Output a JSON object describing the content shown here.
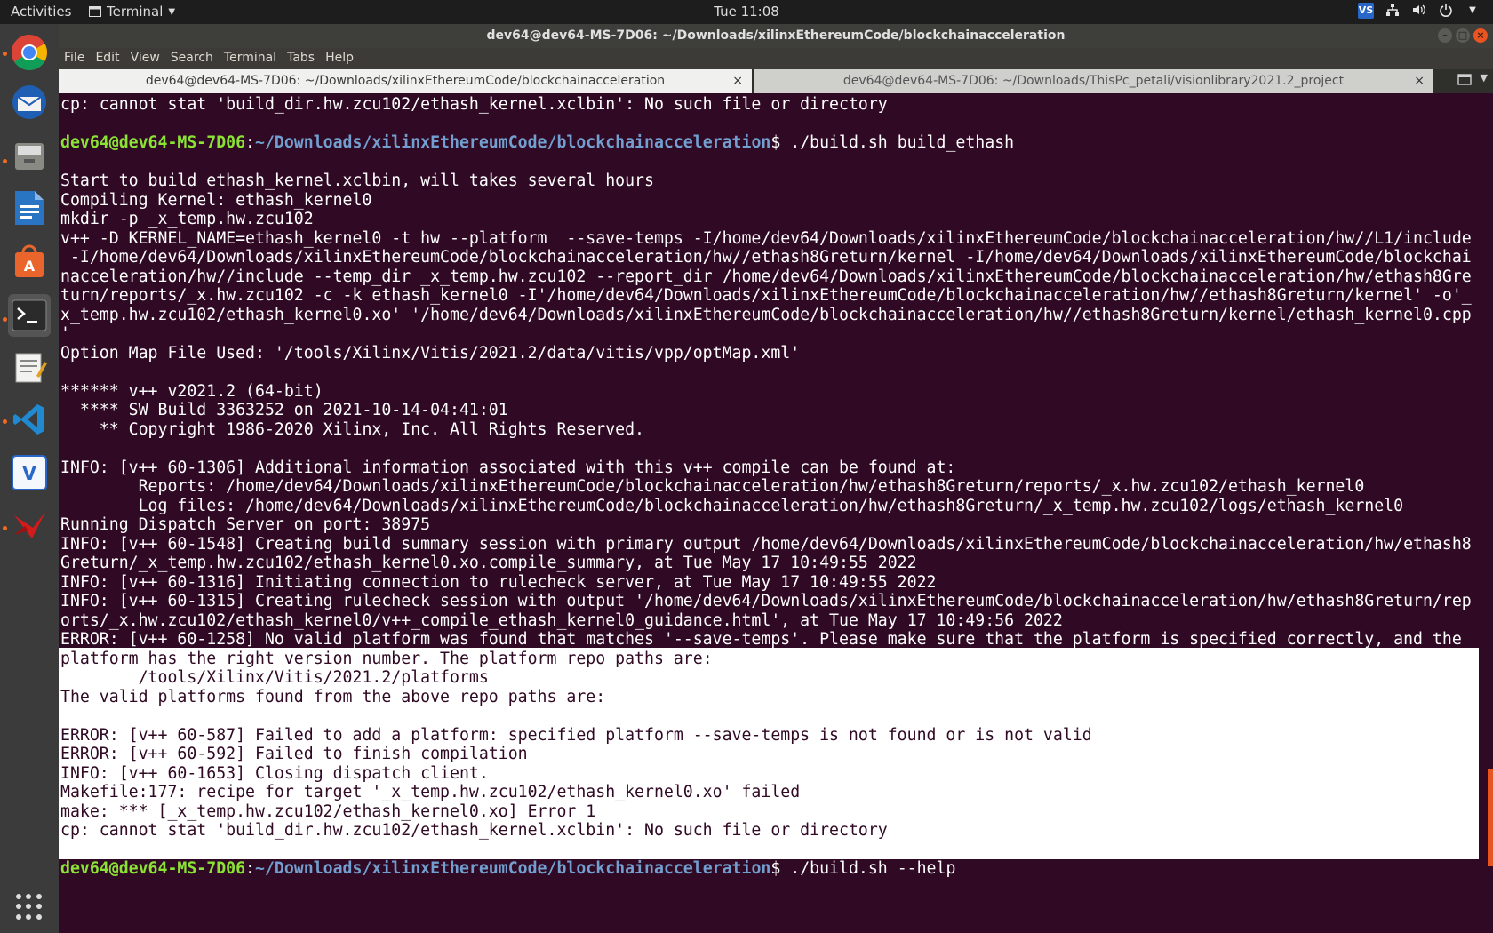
{
  "topbar": {
    "activities": "Activities",
    "app_name": "Terminal",
    "clock": "Tue 11:08",
    "tray_badge": "VS"
  },
  "dock": {
    "items": [
      "chrome",
      "thunderbird",
      "files",
      "writer",
      "software",
      "terminal",
      "text-editor",
      "vscode",
      "vitis",
      "xilinx"
    ]
  },
  "window": {
    "title": "dev64@dev64-MS-7D06: ~/Downloads/xilinxEthereumCode/blockchainacceleration",
    "menu": [
      "File",
      "Edit",
      "View",
      "Search",
      "Terminal",
      "Tabs",
      "Help"
    ],
    "tabs": [
      {
        "label": "dev64@dev64-MS-7D06: ~/Downloads/xilinxEthereumCode/blockchainacceleration",
        "active": true
      },
      {
        "label": "dev64@dev64-MS-7D06: ~/Downloads/ThisPc_petali/visionlibrary2021.2_project",
        "active": false
      }
    ],
    "tab_close": "×"
  },
  "terminal": {
    "prompt_user": "dev64@dev64-MS-7D06",
    "prompt_path": "~/Downloads/xilinxEthereumCode/blockchainacceleration",
    "lines": [
      "cp: cannot stat 'build_dir.hw.zcu102/ethash_kernel.xclbin': No such file or directory",
      "",
      "$ ./build.sh build_ethash",
      "",
      "Start to build ethash_kernel.xclbin, will takes several hours",
      "Compiling Kernel: ethash_kernel0",
      "mkdir -p _x_temp.hw.zcu102",
      "v++ -D KERNEL_NAME=ethash_kernel0 -t hw --platform  --save-temps -I/home/dev64/Downloads/xilinxEthereumCode/blockchainacceleration/hw//L1/include",
      " -I/home/dev64/Downloads/xilinxEthereumCode/blockchainacceleration/hw//ethash8Greturn/kernel -I/home/dev64/Downloads/xilinxEthereumCode/blockchai",
      "nacceleration/hw//include --temp_dir _x_temp.hw.zcu102 --report_dir /home/dev64/Downloads/xilinxEthereumCode/blockchainacceleration/hw/ethash8Gre",
      "turn/reports/_x.hw.zcu102 -c -k ethash_kernel0 -I'/home/dev64/Downloads/xilinxEthereumCode/blockchainacceleration/hw//ethash8Greturn/kernel' -o'_",
      "x_temp.hw.zcu102/ethash_kernel0.xo' '/home/dev64/Downloads/xilinxEthereumCode/blockchainacceleration/hw//ethash8Greturn/kernel/ethash_kernel0.cpp",
      "'",
      "Option Map File Used: '/tools/Xilinx/Vitis/2021.2/data/vitis/vpp/optMap.xml'",
      "",
      "****** v++ v2021.2 (64-bit)",
      "  **** SW Build 3363252 on 2021-10-14-04:41:01",
      "    ** Copyright 1986-2020 Xilinx, Inc. All Rights Reserved.",
      "",
      "INFO: [v++ 60-1306] Additional information associated with this v++ compile can be found at:",
      "        Reports: /home/dev64/Downloads/xilinxEthereumCode/blockchainacceleration/hw/ethash8Greturn/reports/_x.hw.zcu102/ethash_kernel0",
      "        Log files: /home/dev64/Downloads/xilinxEthereumCode/blockchainacceleration/hw/ethash8Greturn/_x_temp.hw.zcu102/logs/ethash_kernel0",
      "Running Dispatch Server on port: 38975",
      "INFO: [v++ 60-1548] Creating build summary session with primary output /home/dev64/Downloads/xilinxEthereumCode/blockchainacceleration/hw/ethash8",
      "Greturn/_x_temp.hw.zcu102/ethash_kernel0.xo.compile_summary, at Tue May 17 10:49:55 2022",
      "INFO: [v++ 60-1316] Initiating connection to rulecheck server, at Tue May 17 10:49:55 2022",
      "INFO: [v++ 60-1315] Creating rulecheck session with output '/home/dev64/Downloads/xilinxEthereumCode/blockchainacceleration/hw/ethash8Greturn/rep",
      "orts/_x.hw.zcu102/ethash_kernel0/v++_compile_ethash_kernel0_guidance.html', at Tue May 17 10:49:56 2022",
      "ERROR: [v++ 60-1258] No valid platform was found that matches '--save-temps'. Please make sure that the platform is specified correctly, and the",
      "platform has the right version number. The platform repo paths are:",
      "        /tools/Xilinx/Vitis/2021.2/platforms",
      "The valid platforms found from the above repo paths are:",
      "",
      "ERROR: [v++ 60-587] Failed to add a platform: specified platform --save-temps is not found or is not valid",
      "ERROR: [v++ 60-592] Failed to finish compilation",
      "INFO: [v++ 60-1653] Closing dispatch client.",
      "Makefile:177: recipe for target '_x_temp.hw.zcu102/ethash_kernel0.xo' failed",
      "make: *** [_x_temp.hw.zcu102/ethash_kernel0.xo] Error 1",
      "cp: cannot stat 'build_dir.hw.zcu102/ethash_kernel.xclbin': No such file or directory",
      "",
      "$ ./build.sh --help"
    ]
  }
}
